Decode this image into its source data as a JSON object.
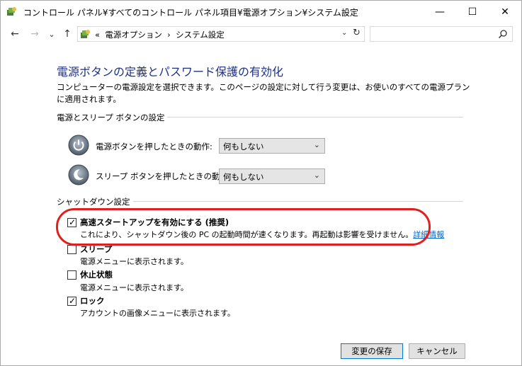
{
  "window": {
    "title": "コントロール パネル¥すべてのコントロール パネル項目¥電源オプション¥システム設定",
    "min_glyph": "—",
    "max_glyph": "☐",
    "close_glyph": "✕"
  },
  "nav": {
    "back_glyph": "←",
    "forward_glyph": "→",
    "recent_glyph": "⌄",
    "up_glyph": "↑",
    "breadcrumb_prefix": "«",
    "breadcrumb_1": "電源オプション",
    "breadcrumb_sep": "›",
    "breadcrumb_2": "システム設定",
    "address_drop_glyph": "⌄",
    "refresh_glyph": "↻",
    "search_placeholder": ""
  },
  "page": {
    "heading": "電源ボタンの定義とパスワード保護の有効化",
    "description": "コンピューターの電源設定を選択できます。このページの設定に対して行う変更は、お使いのすべての電源プランに適用されます。"
  },
  "power_group": {
    "title": "電源とスリープ ボタンの設定",
    "power_button_label": "電源ボタンを押したときの動作:",
    "power_button_value": "何もしない",
    "sleep_button_label": "スリープ ボタンを押したときの動作:",
    "sleep_button_value": "何もしない",
    "chevron_glyph": "⌄"
  },
  "shutdown_group": {
    "title": "シャットダウン設定",
    "options": [
      {
        "label": "高速スタートアップを有効にする (推奨)",
        "desc": "これにより、シャットダウン後の PC の起動時間が速くなります。再起動は影響を受けません。",
        "link": "詳細情報",
        "checked": true
      },
      {
        "label": "スリープ",
        "desc": "電源メニューに表示されます。",
        "checked": false
      },
      {
        "label": "休止状態",
        "desc": "電源メニューに表示されます。",
        "checked": false
      },
      {
        "label": "ロック",
        "desc": "アカウントの画像メニューに表示されます。",
        "checked": true
      }
    ],
    "check_glyph": "✓"
  },
  "footer": {
    "save_label": "変更の保存",
    "cancel_label": "キャンセル"
  },
  "colors": {
    "heading": "#1e3287",
    "link": "#0066cc",
    "highlight": "#e0201e"
  }
}
